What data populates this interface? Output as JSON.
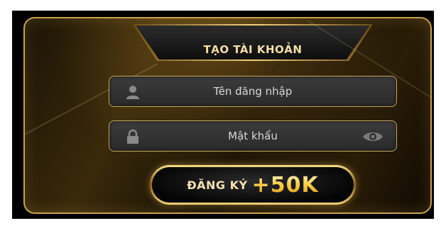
{
  "form": {
    "title": "TẠO TÀI KHOẢN",
    "username_placeholder": "Tên đăng nhập",
    "password_placeholder": "Mật khẩu",
    "register_label": "ĐĂNG KÝ",
    "register_bonus": "+50K"
  },
  "icons": {
    "username": "user-icon",
    "password": "lock-icon",
    "toggle": "eye-icon"
  },
  "colors": {
    "gold": "#c9a24a",
    "title_text": "#f4dfa6",
    "bonus": "#ffd04a"
  }
}
